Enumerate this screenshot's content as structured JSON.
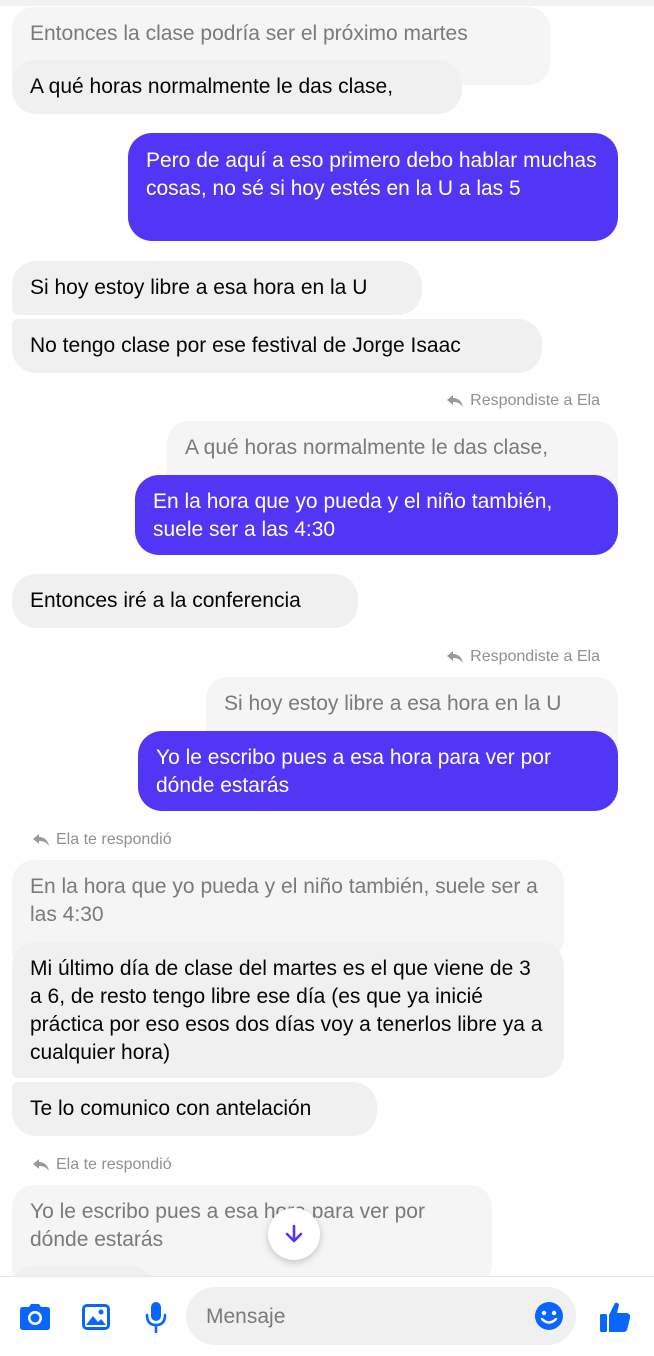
{
  "messages": [
    {
      "kind": "quoted",
      "text": "Entonces la clase podría ser el próximo martes"
    },
    {
      "kind": "in",
      "text": "A qué horas normalmente le das clase,"
    },
    {
      "kind": "out",
      "text": "Pero de aquí a eso primero debo hablar muchas cosas, no sé si hoy estés en la U a las 5"
    },
    {
      "kind": "in",
      "text": "Si hoy estoy libre a esa hora en la U"
    },
    {
      "kind": "in",
      "text": "No tengo clase por ese festival de Jorge Isaac"
    },
    {
      "kind": "meta",
      "text": "Respondiste a Ela"
    },
    {
      "kind": "quoted",
      "text": "A qué horas normalmente le das clase,"
    },
    {
      "kind": "out",
      "text": "En la hora que yo pueda y el niño también, suele ser a las 4:30"
    },
    {
      "kind": "in",
      "text": "Entonces iré a la conferencia"
    },
    {
      "kind": "meta",
      "text": "Respondiste a Ela"
    },
    {
      "kind": "quoted",
      "text": "Si hoy estoy libre a esa hora en la U"
    },
    {
      "kind": "out",
      "text": "Yo le escribo pues a esa hora para ver por dónde estarás"
    },
    {
      "kind": "meta",
      "text": "Ela te respondió"
    },
    {
      "kind": "quoted",
      "text": "En la hora que yo pueda y el niño también, suele ser a las 4:30"
    },
    {
      "kind": "in",
      "text": "Mi último día de clase del martes es el que viene de 3 a 6, de resto tengo libre ese día  (es que ya inicié práctica por eso esos dos días voy a tenerlos libre ya a cualquier hora)"
    },
    {
      "kind": "in",
      "text": "Te lo comunico con antelación"
    },
    {
      "kind": "meta",
      "text": "Ela te respondió"
    },
    {
      "kind": "quoted",
      "text": "Yo le escribo pues a esa hora para ver por dónde estarás"
    }
  ],
  "composer": {
    "placeholder": "Mensaje",
    "icons": [
      "camera-icon",
      "image-icon",
      "microphone-icon",
      "emoji-icon",
      "thumbs-up-icon"
    ]
  },
  "colors": {
    "accent": "#5236f5",
    "icon": "#0866ff",
    "incoming": "#f0f0f0"
  }
}
